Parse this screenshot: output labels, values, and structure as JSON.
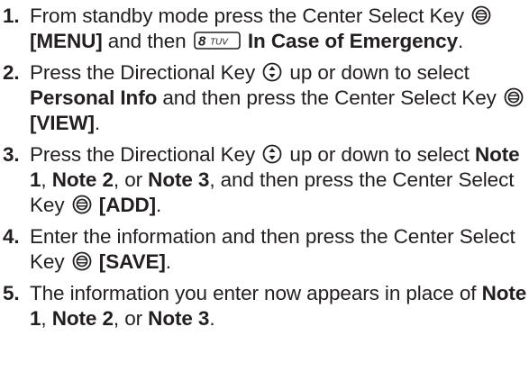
{
  "steps": [
    {
      "number": "1.",
      "t1": "From standby mode press the Center Select Key",
      "key1": "[MENU]",
      "t2": "and then",
      "key2": "In Case of Emergency",
      "t3": ".",
      "keypad_label": "8 TUV"
    },
    {
      "number": "2.",
      "t1": "Press the Directional Key",
      "t2": "up or down to select",
      "b1": "Personal Info",
      "t3": "and then press the Center Select Key",
      "key1": "[VIEW]",
      "t4": "."
    },
    {
      "number": "3.",
      "t1": "Press the Directional Key",
      "t2": "up or down to select",
      "b1": "Note 1",
      "t3": ",",
      "b2": "Note 2",
      "t4": ", or",
      "b3": "Note 3",
      "t5": ", and then press the Center Select Key",
      "key1": "[ADD]",
      "t6": "."
    },
    {
      "number": "4.",
      "t1": "Enter the information and then press the Center Select Key",
      "key1": "[SAVE]",
      "t2": "."
    },
    {
      "number": "5.",
      "t1": "The information you enter now appears in place of",
      "b1": "Note 1",
      "t2": ",",
      "b2": "Note 2",
      "t3": ", or",
      "b3": "Note 3",
      "t4": "."
    }
  ],
  "icons": {
    "center_select": "center-select-key-icon",
    "directional": "directional-key-icon",
    "keypad_8": "keypad-8-tuv-icon"
  }
}
